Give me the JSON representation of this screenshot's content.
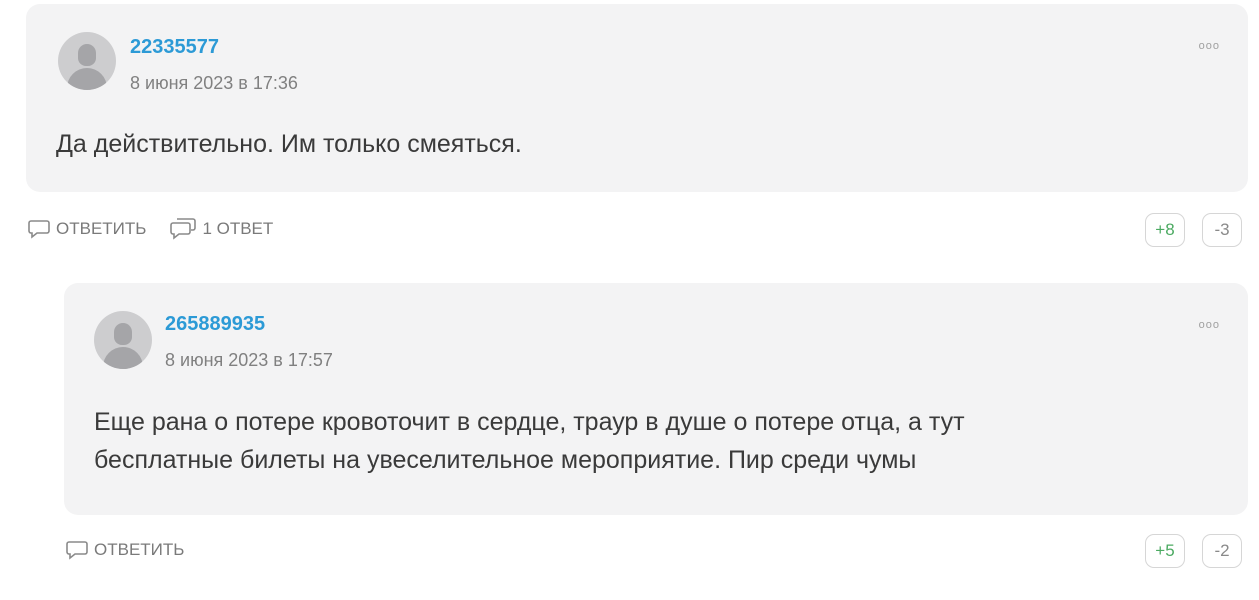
{
  "comments": [
    {
      "author": "22335577",
      "date": "8 июня 2023 в 17:36",
      "text": "Да действительно. Им только смеяться.",
      "menu": "ooo",
      "actions": {
        "reply_label": "ОТВЕТИТЬ",
        "replies_label": "1 ОТВЕТ"
      },
      "votes": {
        "up": "+8",
        "down": "-3"
      }
    },
    {
      "author": "265889935",
      "date": "8 июня 2023 в 17:57",
      "text_line1": "Еще рана о потере кровоточит в сердце, траур в душе о потере отца, а тут",
      "text_line2": "бесплатные билеты на увеселительное мероприятие. Пир среди чумы",
      "menu": "ooo",
      "actions": {
        "reply_label": "ОТВЕТИТЬ"
      },
      "votes": {
        "up": "+5",
        "down": "-2"
      }
    }
  ],
  "colors": {
    "author": "#2c9ad6",
    "upvote": "#4caa62",
    "card_bg": "#f3f3f4"
  },
  "icons": {
    "reply": "speech-bubble-icon",
    "replies": "double-speech-bubble-icon",
    "avatar": "user-placeholder-icon"
  }
}
